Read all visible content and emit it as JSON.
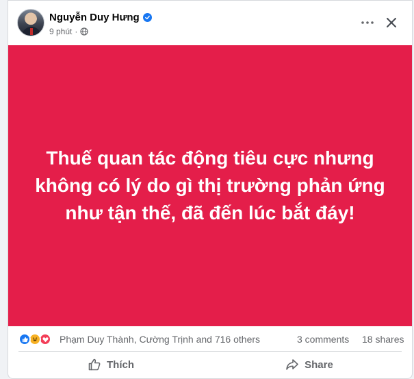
{
  "post": {
    "author": "Nguyễn Duy Hưng",
    "time": "9 phút",
    "separator": "·",
    "text": "Thuế quan tác động tiêu cực nhưng không có lý do gì thị trường phản ứng như tận thế, đã đến lúc bắt đáy!",
    "image_background": "#e41e4a"
  },
  "engagement": {
    "reactors": "Phạm Duy Thành, Cường Trịnh and 716 others",
    "comments": "3 comments",
    "shares": "18 shares",
    "reaction_icons": [
      "like-icon",
      "haha-icon",
      "love-icon"
    ]
  },
  "actions": {
    "like_label": "Thích",
    "share_label": "Share"
  },
  "colors": {
    "accent": "#1877f2",
    "muted_text": "#65676b"
  }
}
